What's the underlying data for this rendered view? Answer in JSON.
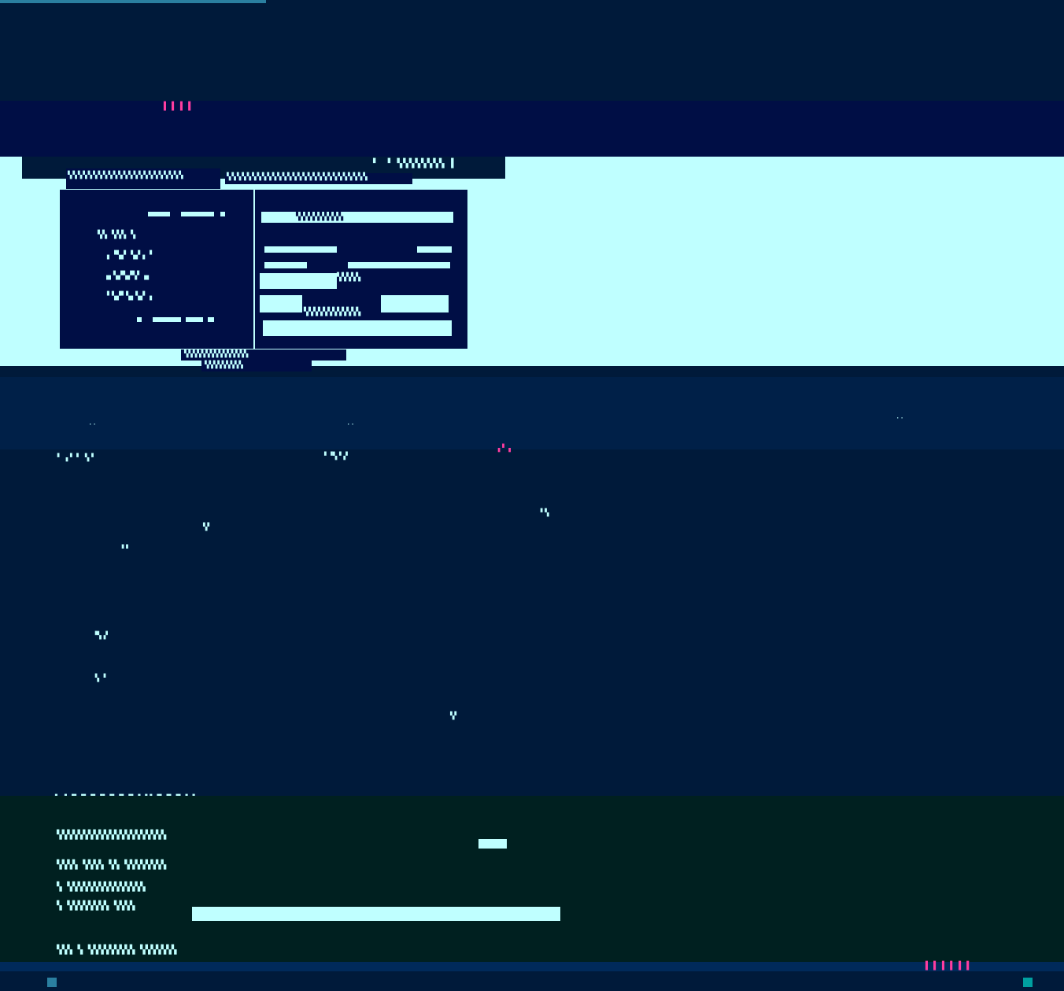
{
  "progress": {
    "value": 0.25
  },
  "nav": {
    "glyphs": "▌▐ ▌▐"
  },
  "hero": {
    "tab_label": "▘ ▝ ▚▚▚▚▚▚▚▚ ▌",
    "subtitle_left": "▚▚▚▚▚▚▚▚▚▚▚▚▚▚▚▚▚▚▚▚▚▚▚",
    "subtitle_right": "▚▚▚▚▚▚▚▚▚▚▚▚▚▚▚▚▚▚▚▚▚▚▚▚▚▚▚▚",
    "panel_lines": [
      "▚▚ ▚▚▚ ▚",
      "▖▝▚▞ ▚▞▗ ▘",
      "▗▖▚▞▚▞▚▘▗▖",
      "▘▚▞▘▚▖▚▞ ▖"
    ],
    "panel_right_lines": [
      "▚▚▚▚▚▚▚▚▚▚",
      "▚▚▚▚▚",
      "▚▚▚▚▚▚▚▚▚▚▚▚"
    ],
    "info": "▚▚▚▚▚▚▚▚▚▚▚▚▚▚▚",
    "info2": "▚▚▚▚▚▚▚▚▚"
  },
  "strip": {
    "marks": [
      "··",
      "··",
      "··"
    ]
  },
  "main": {
    "specks": [
      "▝ ▗▝ ▘ ▚▝",
      "▘▝▚▝▗▘",
      "▗▝ ▖",
      "▝▝▖",
      "▚▘",
      "▝▝",
      "▝▚▗▘",
      "▝▖▝",
      "▚▘"
    ]
  },
  "footer": {
    "header_text": "▚ ▘▝▚▞▚▞▚▞▚▞▚▞▚▞▚▞ ▚▚▞▚▞▚▞▚▞ ▘",
    "lines": [
      "▚▚▚▚▚▚▚▚▚▚▚▚▚▚▚▚▚▚▚▚▚",
      "▚▚▚▚ ▚▚▚▚ ▚▚ ▚▚▚▚▚▚▚▚",
      "▚ ▚▚▚▚▚▚▚▚▚▚▚▚▚▚▚",
      "▚ ▚▚▚▚▚▚▚▚ ▚▚▚▚",
      "▚▚▚ ▚ ▚▚▚▚▚▚▚▚▚ ▚▚▚▚▚▚▚"
    ]
  },
  "taskbar": {
    "right_glyphs": "▌▐ ▌▐ ▌▐"
  }
}
